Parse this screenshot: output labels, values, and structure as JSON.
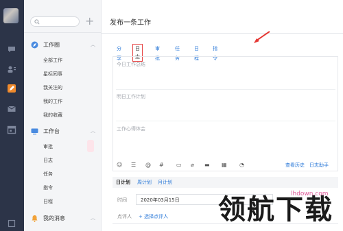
{
  "sidebar": {
    "sections": [
      {
        "label": "工作圈",
        "items": [
          "全部工作",
          "星标同事",
          "我关注的",
          "我的工作",
          "我的收藏"
        ]
      },
      {
        "label": "工作台",
        "items": [
          "审批",
          "日志",
          "任务",
          "指令",
          "日程"
        ]
      },
      {
        "label": "我的消息"
      }
    ]
  },
  "main": {
    "title": "发布一条工作",
    "tabs": [
      "分享",
      "日志",
      "审批",
      "任务",
      "日程",
      "指令"
    ],
    "active_tab": "日志",
    "placeholders": [
      "今日工作总结",
      "明日工作计划",
      "工作心得体会"
    ],
    "toolbar": {
      "history": "查看历史",
      "assistant": "日志助手",
      "icons": [
        "emoji-icon",
        "list-icon",
        "mention-icon",
        "hashtag-icon",
        "image-icon",
        "attachment-icon",
        "archive-icon",
        "table-icon",
        "chart-icon"
      ]
    },
    "plan_tabs": [
      "日计划",
      "周计划",
      "月计划"
    ],
    "time_label": "时间",
    "time_value": "2020年03月15日",
    "reviewer_label": "点评人",
    "reviewer_link": "+ 选择点评人"
  },
  "watermark": {
    "main": "领航下载",
    "small": "lhdown.com"
  },
  "colors": {
    "rail": "#2c3448",
    "link": "#2b79d8",
    "active_border": "#e64545",
    "annotation_arrow": "#e53935"
  }
}
